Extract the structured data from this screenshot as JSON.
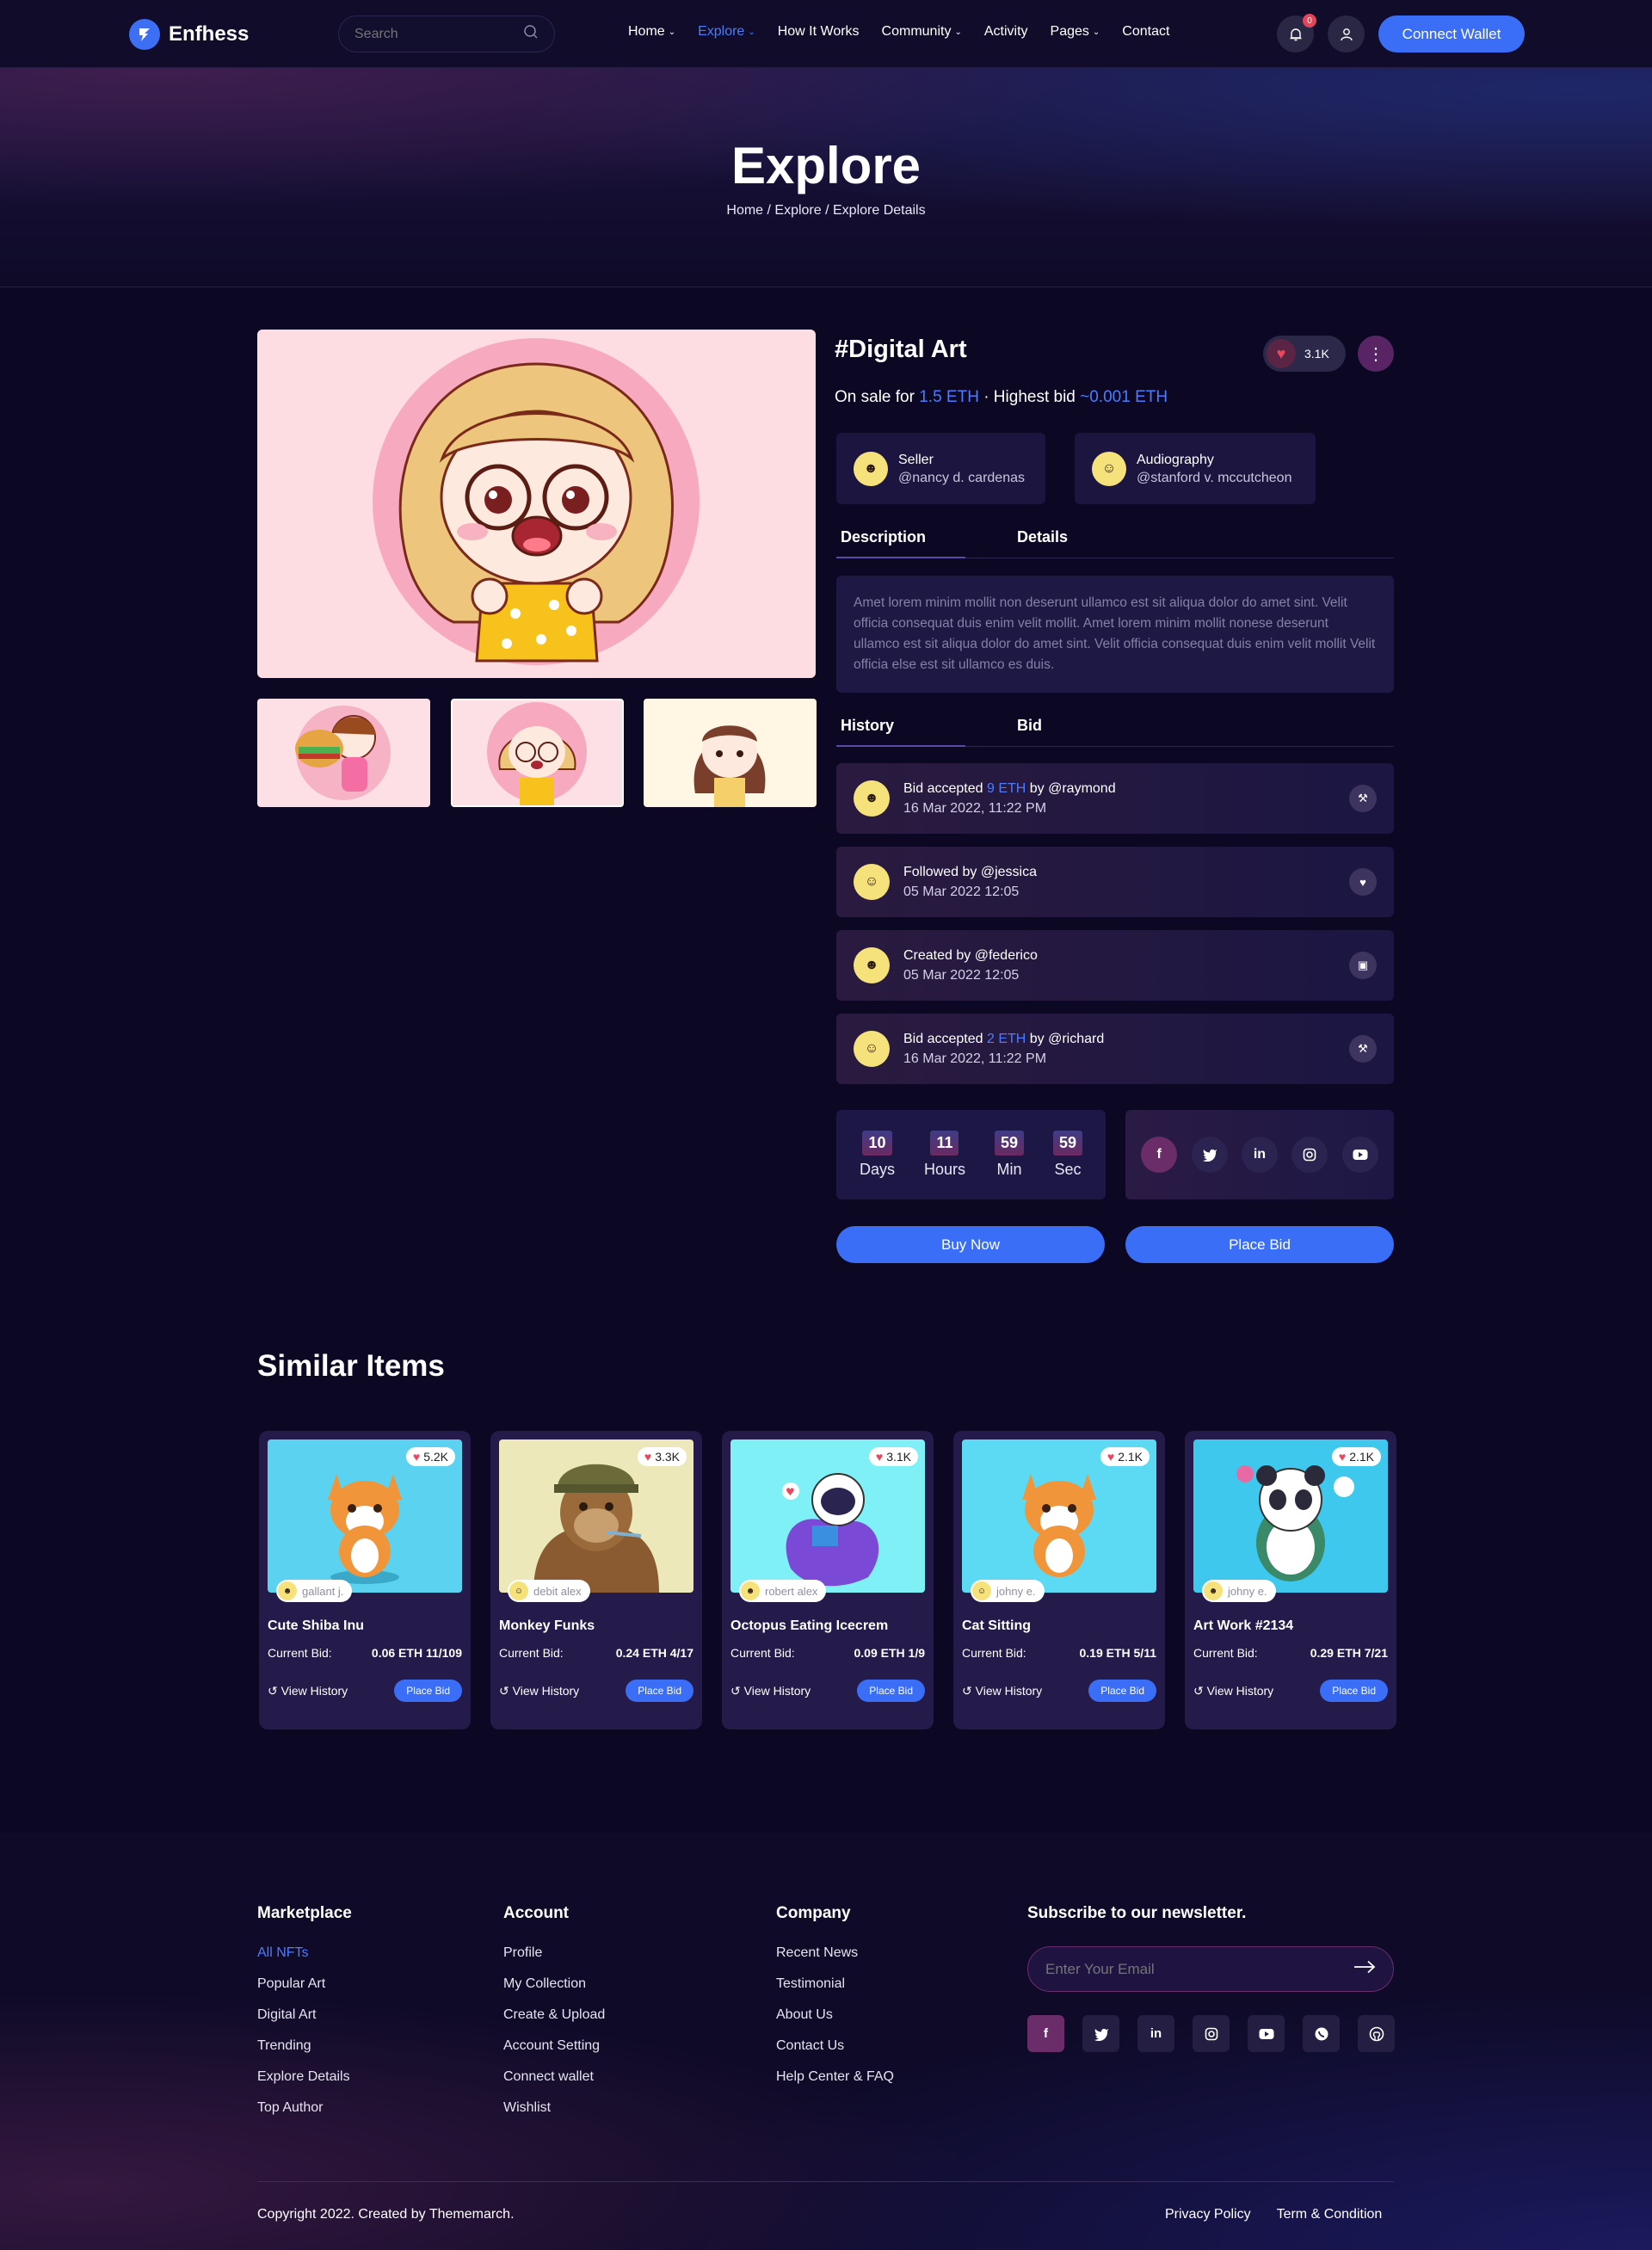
{
  "header": {
    "brand": "Enfhess",
    "search_placeholder": "Search",
    "nav": [
      "Home",
      "Explore",
      "How It Works",
      "Community",
      "Activity",
      "Pages",
      "Contact"
    ],
    "notification_count": "0",
    "connect_label": "Connect Wallet"
  },
  "hero": {
    "title": "Explore",
    "breadcrumb": "Home / Explore / Explore Details"
  },
  "item": {
    "title": "#Digital Art",
    "likes": "3.1K",
    "sale_prefix": "On sale for",
    "price": "1.5 ETH",
    "bid_prefix": "· Highest bid",
    "highest_bid": "~0.001 ETH",
    "seller": {
      "role": "Seller",
      "handle": "@nancy d. cardenas"
    },
    "creator": {
      "role": "Audiography",
      "handle": "@stanford v. mccutcheon"
    },
    "tabs1": [
      "Description",
      "Details"
    ],
    "description": "Amet lorem minim mollit non deserunt ullamco est sit aliqua dolor do amet sint. Velit officia consequat duis enim velit mollit. Amet lorem minim mollit nonese deserunt ullamco est sit aliqua dolor do amet sint. Velit officia consequat duis enim velit mollit Velit officia else est sit ullamco es duis.",
    "tabs2": [
      "History",
      "Bid"
    ],
    "history": [
      {
        "pre": "Bid accepted",
        "amount": "9 ETH",
        "post": "by @raymond",
        "date": "16 Mar 2022, 11:22 PM",
        "icon": "gavel-icon"
      },
      {
        "pre": "Followed by @jessica",
        "amount": "",
        "post": "",
        "date": "05 Mar 2022 12:05",
        "icon": "heart-icon"
      },
      {
        "pre": "Created by @federico",
        "amount": "",
        "post": "",
        "date": "05 Mar 2022 12:05",
        "icon": "image-icon"
      },
      {
        "pre": "Bid accepted",
        "amount": "2 ETH",
        "post": "by @richard",
        "date": "16 Mar 2022, 11:22 PM",
        "icon": "gavel-icon"
      }
    ],
    "countdown": [
      {
        "value": "10",
        "label": "Days"
      },
      {
        "value": "11",
        "label": "Hours"
      },
      {
        "value": "59",
        "label": "Min"
      },
      {
        "value": "59",
        "label": "Sec"
      }
    ],
    "buy_label": "Buy Now",
    "bid_label": "Place Bid"
  },
  "similar": {
    "title": "Similar Items",
    "bid_label": "Current Bid:",
    "history_label": "View History",
    "button_label": "Place Bid",
    "cards": [
      {
        "name": "Cute Shiba Inu",
        "likes": "5.2K",
        "author": "gallant j.",
        "bid": "0.06 ETH 11/109",
        "bg": "#5bd2f0"
      },
      {
        "name": "Monkey Funks",
        "likes": "3.3K",
        "author": "debit alex",
        "bid": "0.24 ETH 4/17",
        "bg": "#ece8b9"
      },
      {
        "name": "Octopus Eating Icecrem",
        "likes": "3.1K",
        "author": "robert alex",
        "bid": "0.09 ETH 1/9",
        "bg": "#7ef0f6"
      },
      {
        "name": "Cat Sitting",
        "likes": "2.1K",
        "author": "johny e.",
        "bid": "0.19 ETH 5/11",
        "bg": "#5cdaf4"
      },
      {
        "name": "Art Work #2134",
        "likes": "2.1K",
        "author": "johny e.",
        "bid": "0.29 ETH 7/21",
        "bg": "#3fc8ee"
      }
    ]
  },
  "footer": {
    "marketplace": {
      "title": "Marketplace",
      "links": [
        "All NFTs",
        "Popular Art",
        "Digital Art",
        "Trending",
        "Explore Details",
        "Top Author"
      ]
    },
    "account": {
      "title": "Account",
      "links": [
        "Profile",
        "My Collection",
        "Create & Upload",
        "Account Setting",
        "Connect wallet",
        "Wishlist"
      ]
    },
    "company": {
      "title": "Company",
      "links": [
        "Recent News",
        "Testimonial",
        "About Us",
        "Contact Us",
        "Help Center & FAQ"
      ]
    },
    "newsletter_title": "Subscribe to our newsletter.",
    "email_placeholder": "Enter Your Email",
    "copyright": "Copyright 2022. Created by Thememarch.",
    "privacy": "Privacy Policy",
    "terms": "Term & Condition"
  },
  "colors": {
    "accent": "#3b6ef6",
    "background": "#0c0824",
    "heart": "#e8475e"
  }
}
